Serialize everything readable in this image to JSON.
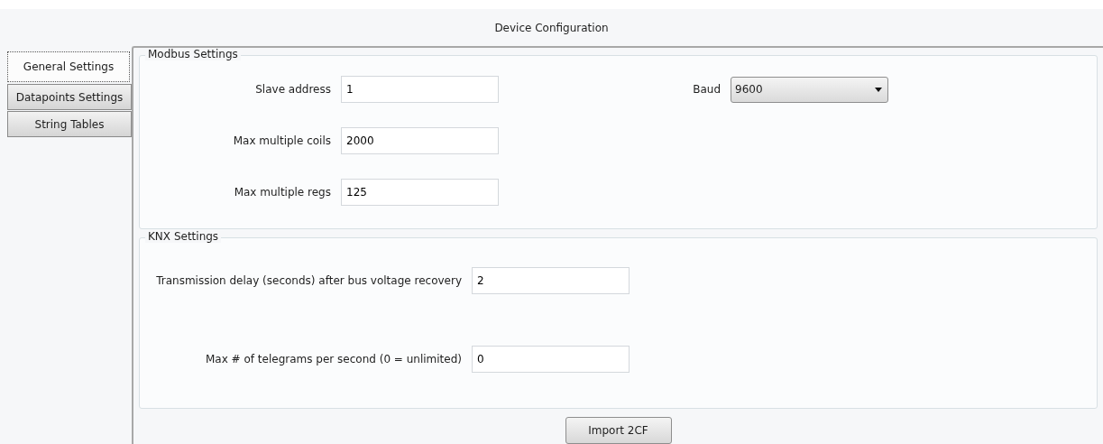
{
  "window": {
    "title": "Device Configuration"
  },
  "tabs": [
    {
      "label": "General Settings",
      "selected": true
    },
    {
      "label": "Datapoints Settings",
      "selected": false
    },
    {
      "label": "String Tables",
      "selected": false
    }
  ],
  "modbus": {
    "title": "Modbus Settings",
    "fields": [
      {
        "label": "Slave address",
        "value": "1"
      },
      {
        "label": "Max multiple coils",
        "value": "2000"
      },
      {
        "label": "Max multiple regs",
        "value": "125"
      }
    ],
    "baud": {
      "label": "Baud",
      "value": "9600"
    }
  },
  "knx": {
    "title": "KNX Settings",
    "fields": [
      {
        "label": "Transmission delay (seconds) after bus voltage recovery",
        "value": "2"
      },
      {
        "label": "Max # of telegrams per second (0 = unlimited)",
        "value": "0"
      }
    ]
  },
  "import_button": "Import 2CF"
}
